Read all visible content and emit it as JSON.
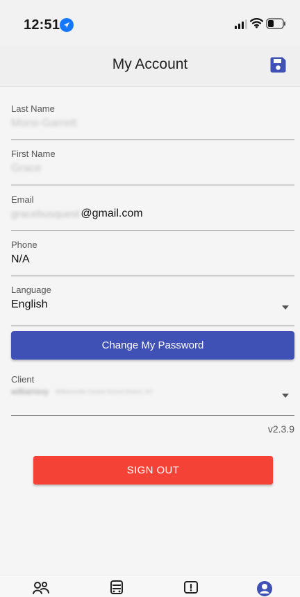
{
  "status_bar": {
    "time": "12:51"
  },
  "header": {
    "title": "My Account",
    "save_icon": "save-icon"
  },
  "form": {
    "last_name": {
      "label": "Last Name",
      "value": "Morsi-Garrett"
    },
    "first_name": {
      "label": "First Name",
      "value": "Grace"
    },
    "email": {
      "label": "Email",
      "prefix": "gracebusquest",
      "suffix": "@gmail.com"
    },
    "phone": {
      "label": "Phone",
      "value": "N/A"
    },
    "language": {
      "label": "Language",
      "value": "English"
    },
    "client": {
      "label": "Client",
      "short": "williamsvy",
      "detail": "Williamsville Central School District, NY"
    }
  },
  "buttons": {
    "change_password": "Change My Password",
    "sign_out": "SIGN OUT"
  },
  "app": {
    "version": "v2.3.9"
  },
  "bottom_nav": {
    "items": [
      {
        "icon": "people-icon"
      },
      {
        "icon": "bus-icon"
      },
      {
        "icon": "alert-icon"
      },
      {
        "icon": "account-icon"
      }
    ]
  },
  "colors": {
    "primary": "#3f51b5",
    "danger": "#f44336",
    "location_blue": "#1677ff"
  }
}
